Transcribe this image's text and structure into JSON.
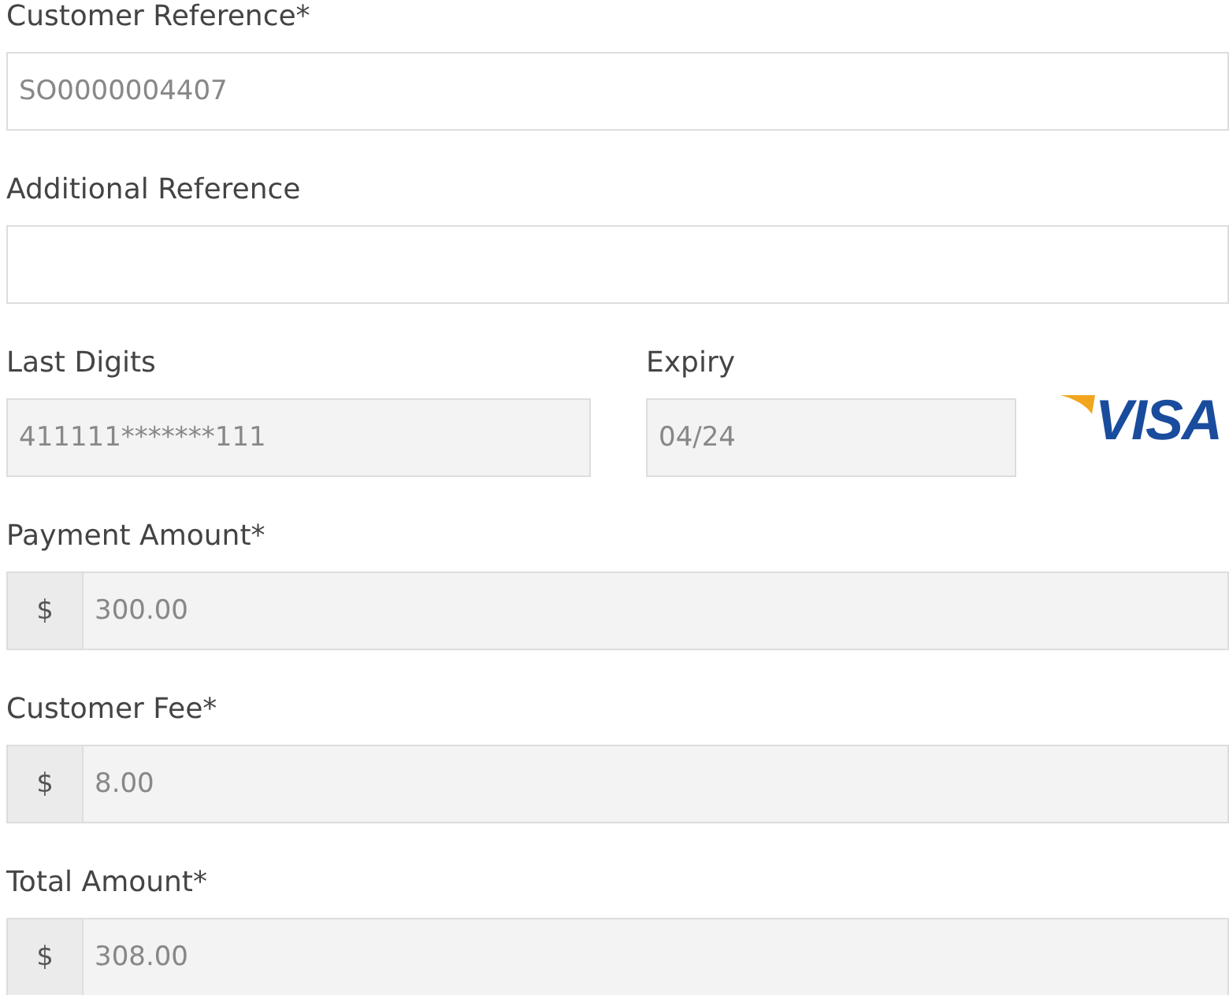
{
  "fields": [
    {
      "kind": "text",
      "label": "Customer Reference*",
      "value": "SO0000004407",
      "disabled": false
    },
    {
      "kind": "text",
      "label": "Additional Reference",
      "disabled": false
    },
    {
      "kind": "card",
      "last_digits": {
        "label": "Last Digits",
        "value": "411111*******111",
        "disabled": true
      },
      "expiry": {
        "label": "Expiry",
        "value": "04/24",
        "disabled": true
      },
      "card_brand": "VISA"
    },
    {
      "kind": "amount",
      "label": "Payment Amount*",
      "prefix": "$",
      "value": "300.00",
      "disabled": true
    },
    {
      "kind": "amount",
      "label": "Customer Fee*",
      "prefix": "$",
      "value": "8.00",
      "disabled": true
    },
    {
      "kind": "amount",
      "label": "Total Amount*",
      "prefix": "$",
      "value": "308.00",
      "disabled": true
    }
  ]
}
